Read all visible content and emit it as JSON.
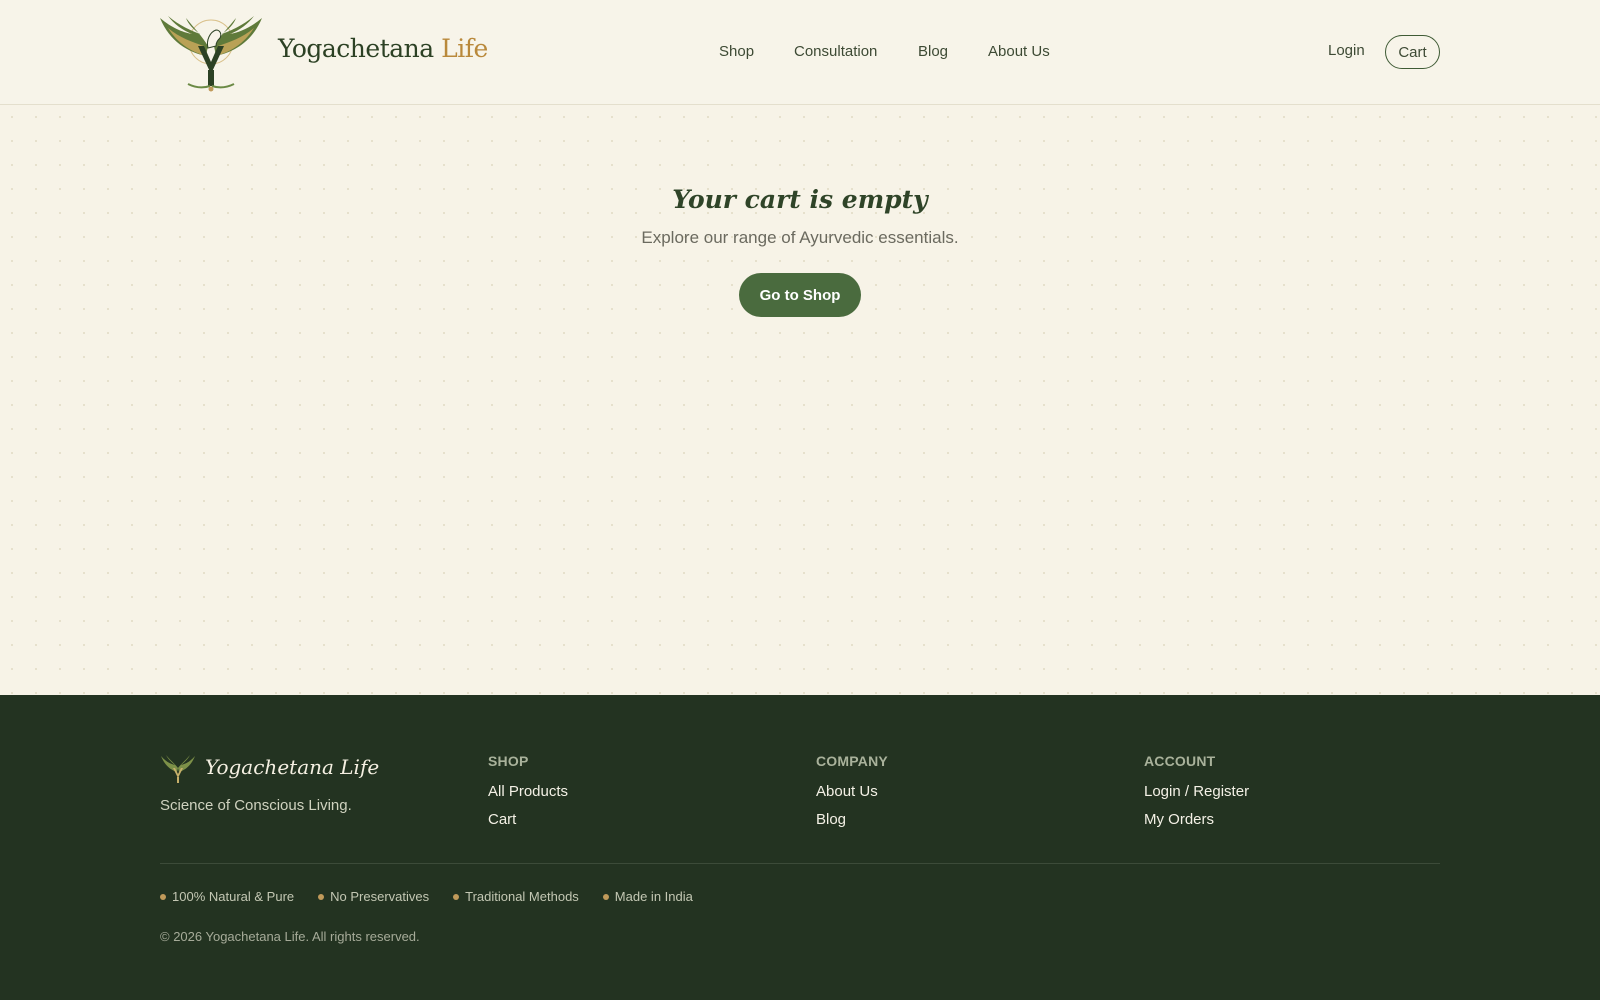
{
  "header": {
    "brand_main": "Yogachetana",
    "brand_accent": "Life",
    "nav": {
      "shop": "Shop",
      "consultation": "Consultation",
      "blog": "Blog",
      "about": "About Us"
    },
    "login_label": "Login",
    "cart_label": "Cart"
  },
  "main": {
    "title": "Your cart is empty",
    "subtitle": "Explore our range of Ayurvedic essentials.",
    "cta_label": "Go to Shop"
  },
  "footer": {
    "brand": "Yogachetana Life",
    "tagline": "Science of Conscious Living.",
    "columns": {
      "shop": {
        "heading": "SHOP",
        "links": [
          "All Products",
          "Cart"
        ]
      },
      "company": {
        "heading": "COMPANY",
        "links": [
          "About Us",
          "Blog"
        ]
      },
      "account": {
        "heading": "ACCOUNT",
        "links": [
          "Login / Register",
          "My Orders"
        ]
      }
    },
    "badges": [
      "100% Natural & Pure",
      "No Preservatives",
      "Traditional Methods",
      "Made in India"
    ],
    "copyright": "© 2026 Yogachetana Life. All rights reserved."
  },
  "colors": {
    "background": "#f7f3e7",
    "primary_green": "#4a6b3e",
    "footer_bg": "#233321",
    "accent_gold": "#b9893b"
  },
  "icons": [
    "winged-horse-logo-icon",
    "footer-logo-icon"
  ]
}
